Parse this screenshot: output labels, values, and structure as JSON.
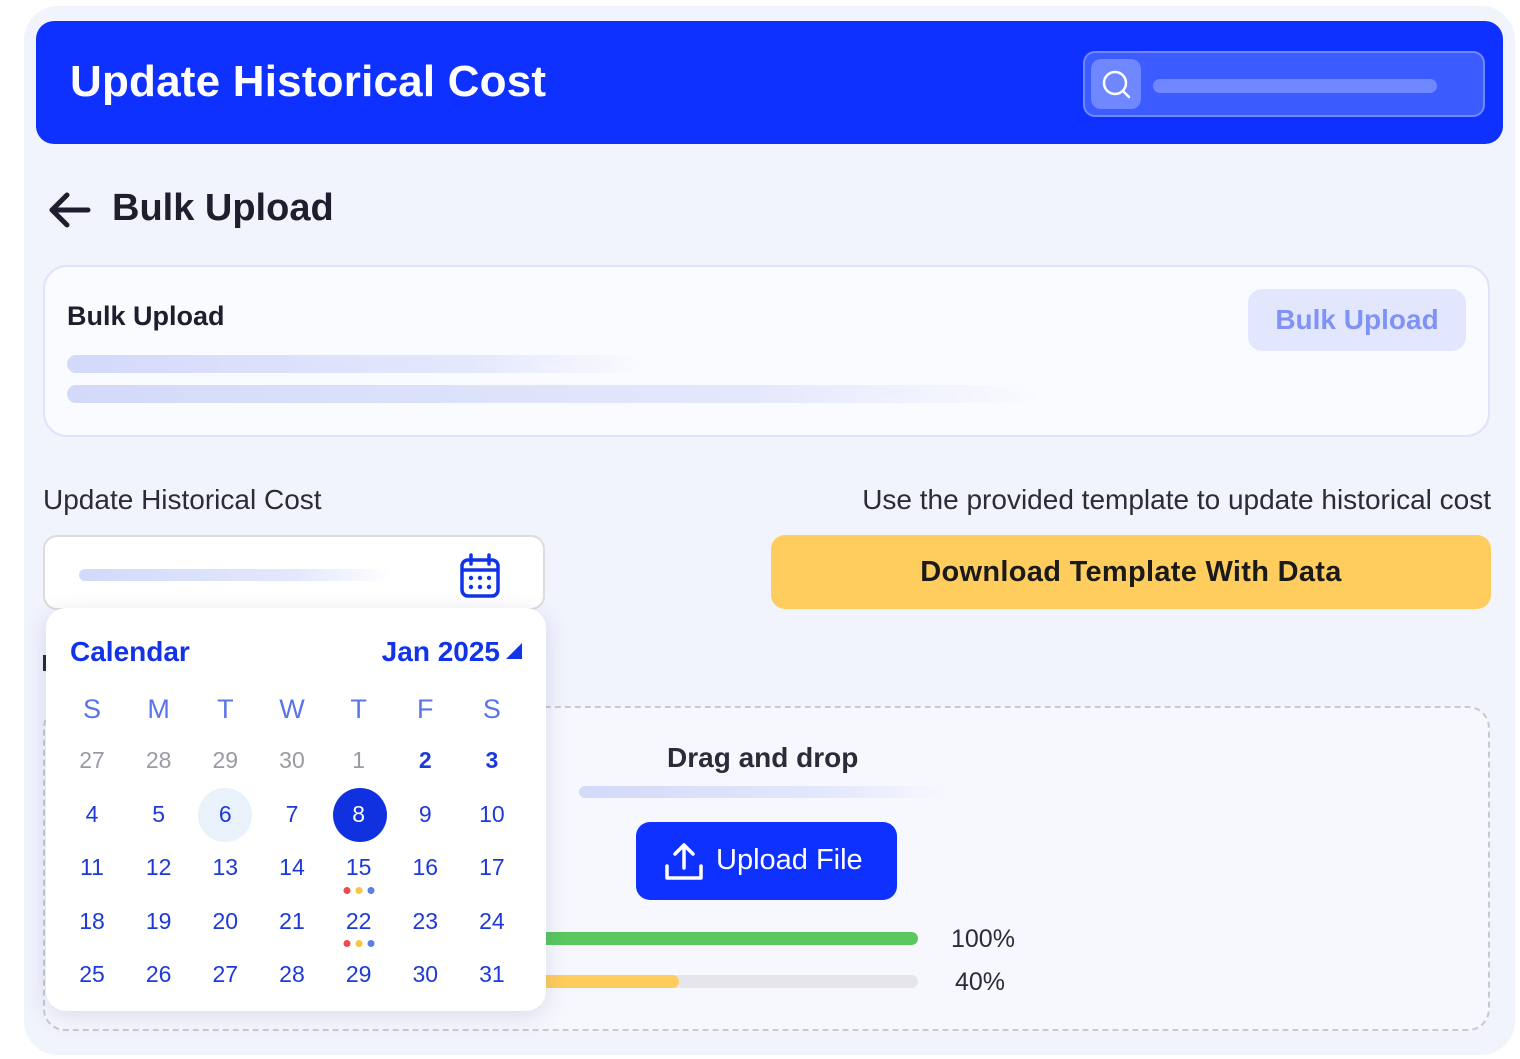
{
  "header": {
    "title": "Update Historical Cost"
  },
  "page": {
    "title": "Bulk Upload"
  },
  "upload_card": {
    "title": "Bulk Upload",
    "button_label": "Bulk Upload"
  },
  "form": {
    "left_label": "Update Historical Cost",
    "right_label": "Use the provided template to update historical cost",
    "download_button": "Download Template With Data"
  },
  "drop_zone": {
    "title": "Drag and drop",
    "upload_button": "Upload File",
    "progress": [
      {
        "label": "100%",
        "value": 100,
        "color": "#5ac85f"
      },
      {
        "label": "40%",
        "value": 40,
        "color": "#ffcd5d"
      }
    ]
  },
  "calendar": {
    "title": "Calendar",
    "month": "Jan 2025",
    "weekdays": [
      "S",
      "M",
      "T",
      "W",
      "T",
      "F",
      "S"
    ],
    "weeks": [
      [
        {
          "d": "27",
          "muted": true
        },
        {
          "d": "28",
          "muted": true
        },
        {
          "d": "29",
          "muted": true
        },
        {
          "d": "30",
          "muted": true
        },
        {
          "d": "1",
          "muted": true
        },
        {
          "d": "2",
          "bold": true
        },
        {
          "d": "3",
          "bold": true
        }
      ],
      [
        {
          "d": "4"
        },
        {
          "d": "5"
        },
        {
          "d": "6",
          "today": true
        },
        {
          "d": "7"
        },
        {
          "d": "8",
          "selected": true
        },
        {
          "d": "9"
        },
        {
          "d": "10"
        }
      ],
      [
        {
          "d": "11"
        },
        {
          "d": "12"
        },
        {
          "d": "13"
        },
        {
          "d": "14"
        },
        {
          "d": "15",
          "dots": [
            "#ef4b4b",
            "#f5c842",
            "#5a7fe0"
          ]
        },
        {
          "d": "16"
        },
        {
          "d": "17"
        }
      ],
      [
        {
          "d": "18"
        },
        {
          "d": "19"
        },
        {
          "d": "20"
        },
        {
          "d": "21"
        },
        {
          "d": "22",
          "dots": [
            "#ef4b4b",
            "#f5c842",
            "#5a7fe0"
          ]
        },
        {
          "d": "23"
        },
        {
          "d": "24"
        }
      ],
      [
        {
          "d": "25"
        },
        {
          "d": "26"
        },
        {
          "d": "27"
        },
        {
          "d": "28"
        },
        {
          "d": "29"
        },
        {
          "d": "30"
        },
        {
          "d": "31"
        }
      ]
    ]
  }
}
